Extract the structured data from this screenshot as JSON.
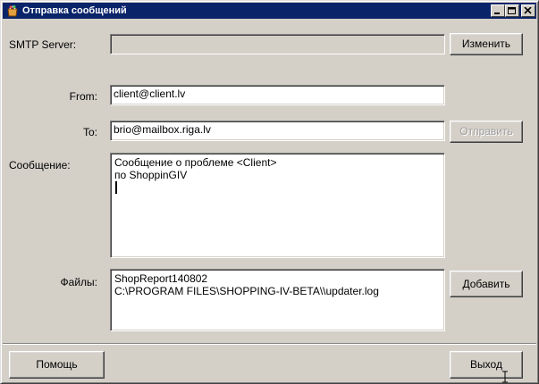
{
  "window": {
    "title": "Отправка сообщений",
    "icon": "app-icon",
    "controls": [
      "minimize-icon",
      "maximize-icon",
      "close-icon"
    ],
    "title_bar_color": "#0a246a"
  },
  "form": {
    "smtp_label": "SMTP Server:",
    "smtp_value": "",
    "change_button": "Изменить",
    "from_label": "From:",
    "from_value": "client@client.lv",
    "to_label": "To:",
    "to_value": "brio@mailbox.riga.lv",
    "send_button": "Отправить",
    "message_label": "Сообщение:",
    "message_lines": [
      "Сообщение о проблеме <Client>",
      "по ShoppinGIV"
    ],
    "files_label": "Файлы:",
    "files_lines": [
      "ShopReport140802",
      "C:\\PROGRAM FILES\\SHOPPING-IV-BETA\\\\updater.log"
    ],
    "add_button": "Добавить"
  },
  "footer": {
    "help_button": "Помощь",
    "exit_button": "Выход"
  }
}
